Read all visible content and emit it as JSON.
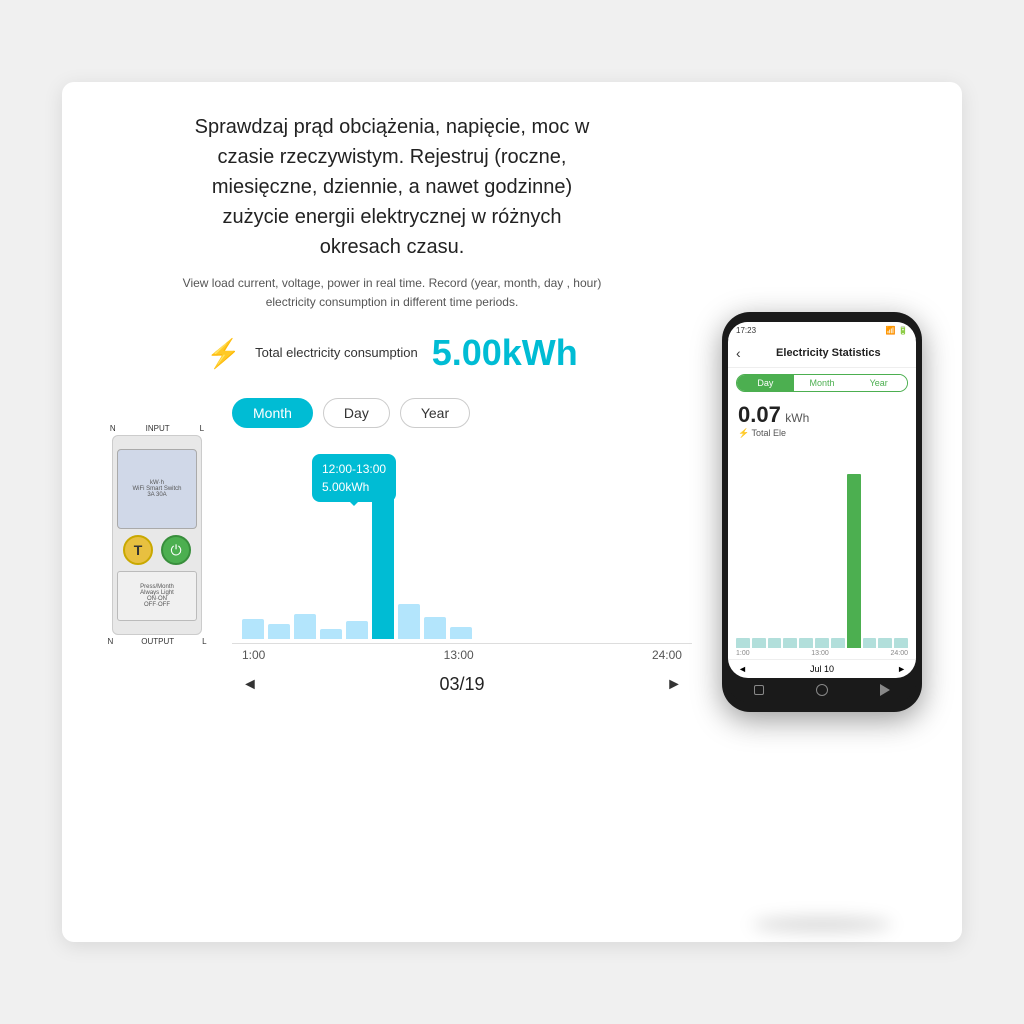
{
  "page": {
    "background_color": "#f0f0f0"
  },
  "left": {
    "polish_title": "Sprawdzaj prąd obciążenia, napięcie, moc w czasie rzeczywistym. Rejestruj (roczne, miesięczne, dziennie, a nawet godzinne) zużycie energii elektrycznej w różnych okresach czasu.",
    "english_subtitle": "View load current, voltage, power in real time. Record (year, month, day , hour) electricity consumption in different time periods.",
    "consumption_label": "Total electricity consumption",
    "consumption_value": "5.00kWh",
    "tabs": [
      {
        "label": "Month",
        "active": true
      },
      {
        "label": "Day",
        "active": false
      },
      {
        "label": "Year",
        "active": false
      }
    ],
    "tooltip": {
      "time": "12:00-13:00",
      "value": "5.00kWh"
    },
    "x_labels": [
      "1:00",
      "13:00",
      "24:00"
    ],
    "nav": {
      "prev": "◄",
      "date": "03/19",
      "next": "►"
    }
  },
  "phone": {
    "status_bar": {
      "time": "17:23",
      "icons": "🔔 ⚙"
    },
    "header_title": "Electricity Statistics",
    "tabs": [
      {
        "label": "Day",
        "active": true
      },
      {
        "label": "Month",
        "active": false
      },
      {
        "label": "Year",
        "active": false
      }
    ],
    "value": "0.07",
    "unit": "kWh",
    "total_label": "⚡ Total Ele",
    "x_labels": [
      "1:00",
      "13:00",
      "24:00"
    ],
    "nav": {
      "prev": "◄",
      "date": "Jul 10",
      "next": "►"
    }
  }
}
